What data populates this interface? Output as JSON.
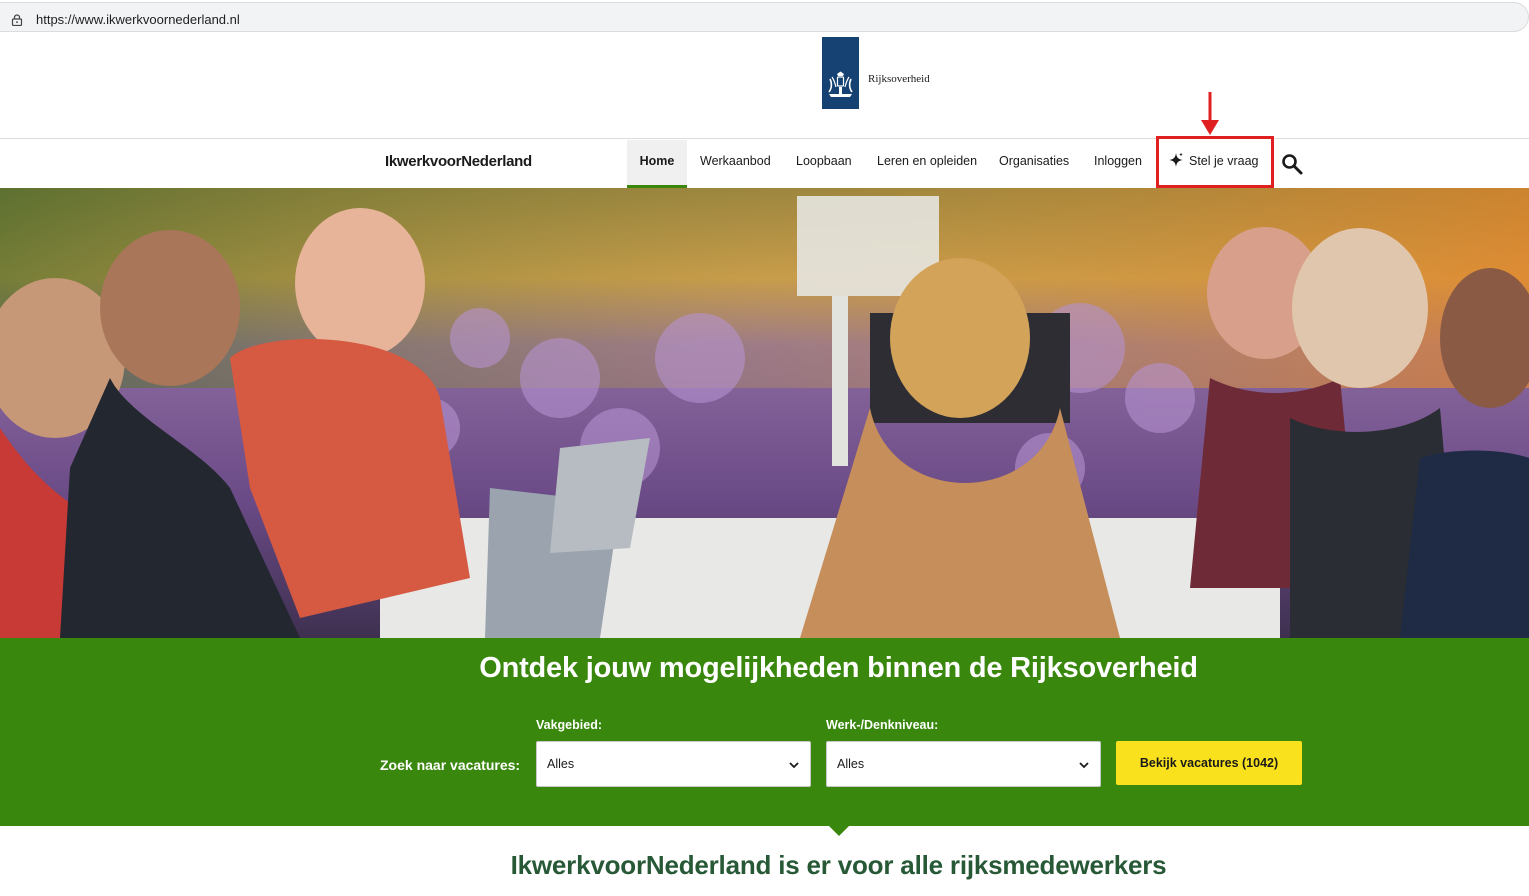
{
  "browser": {
    "url": "https://www.ikwerkvoornederland.nl"
  },
  "header": {
    "wordmark": "Rijksoverheid"
  },
  "nav": {
    "site_name_bold": "Ikwerkvoor",
    "site_name_rest": "Nederland",
    "items": [
      {
        "label": "Home",
        "active": true
      },
      {
        "label": "Werkaanbod"
      },
      {
        "label": "Loopbaan"
      },
      {
        "label": "Leren en opleiden"
      },
      {
        "label": "Organisaties"
      },
      {
        "label": "Inloggen"
      },
      {
        "label": "Stel je vraag",
        "icon": "sparkle-icon"
      }
    ],
    "search_icon": "search-icon",
    "highlight_color": "#e02020"
  },
  "hero": {
    "alt_visual": "photo"
  },
  "search_band": {
    "headline": "Ontdek jouw mogelijkheden binnen de Rijksoverheid",
    "label": "Zoek naar vacatures:",
    "field1": {
      "label": "Vakgebied:",
      "value": "Alles"
    },
    "field2": {
      "label": "Werk-/Denkniveau:",
      "value": "Alles"
    },
    "button": "Bekijk vacatures (1042)",
    "background": "#39870c",
    "button_color": "#f9e11e"
  },
  "intro": {
    "heading": "IkwerkvoorNederland is er voor alle rijksmedewerkers"
  }
}
